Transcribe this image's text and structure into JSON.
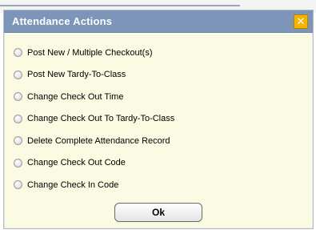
{
  "dialog": {
    "title": "Attendance Actions",
    "close_glyph": "✕",
    "options": [
      {
        "label": "Post New / Multiple Checkout(s)"
      },
      {
        "label": "Post New Tardy-To-Class"
      },
      {
        "label": "Change Check Out Time"
      },
      {
        "label": "Change Check Out To Tardy-To-Class"
      },
      {
        "label": "Delete Complete Attendance Record"
      },
      {
        "label": "Change Check Out Code"
      },
      {
        "label": "Change Check In Code"
      }
    ],
    "ok_label": "Ok"
  },
  "colors": {
    "titlebar": "#7d95b9",
    "body_bg": "#fbfbe3",
    "close_bg": "#f5b400"
  }
}
